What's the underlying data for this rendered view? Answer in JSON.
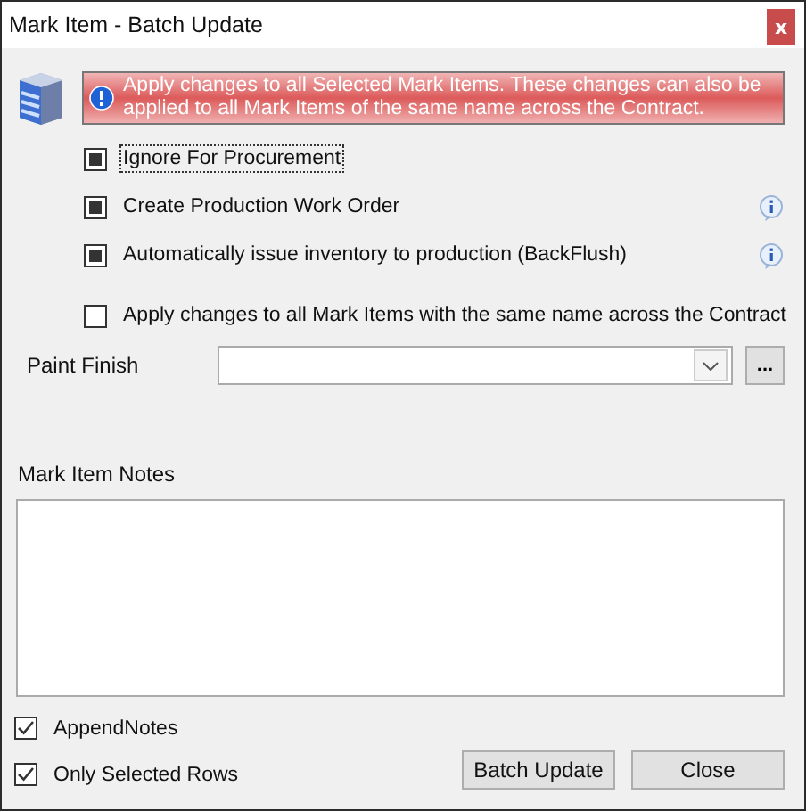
{
  "window": {
    "title": "Mark Item - Batch Update",
    "close": "x"
  },
  "banner": {
    "text": "Apply changes to all Selected Mark Items. These changes can also be applied to all Mark Items of the same name across the Contract."
  },
  "options": [
    {
      "label": "Ignore For Procurement",
      "checked": true,
      "indeterminate": true,
      "focused": true,
      "info": false
    },
    {
      "label": "Create Production Work Order",
      "checked": true,
      "indeterminate": true,
      "focused": false,
      "info": true
    },
    {
      "label": "Automatically issue inventory to production (BackFlush)",
      "checked": true,
      "indeterminate": true,
      "focused": false,
      "info": true
    }
  ],
  "apply_all": {
    "label": "Apply changes to all Mark Items with the same name across the Contract",
    "checked": false
  },
  "paint_finish": {
    "label": "Paint Finish",
    "browse": "..."
  },
  "notes": {
    "label": "Mark Item Notes"
  },
  "footer_options": [
    {
      "label": "AppendNotes",
      "checked": true
    },
    {
      "label": "Only Selected Rows",
      "checked": true
    }
  ],
  "buttons": [
    "Batch Update",
    "Close"
  ]
}
